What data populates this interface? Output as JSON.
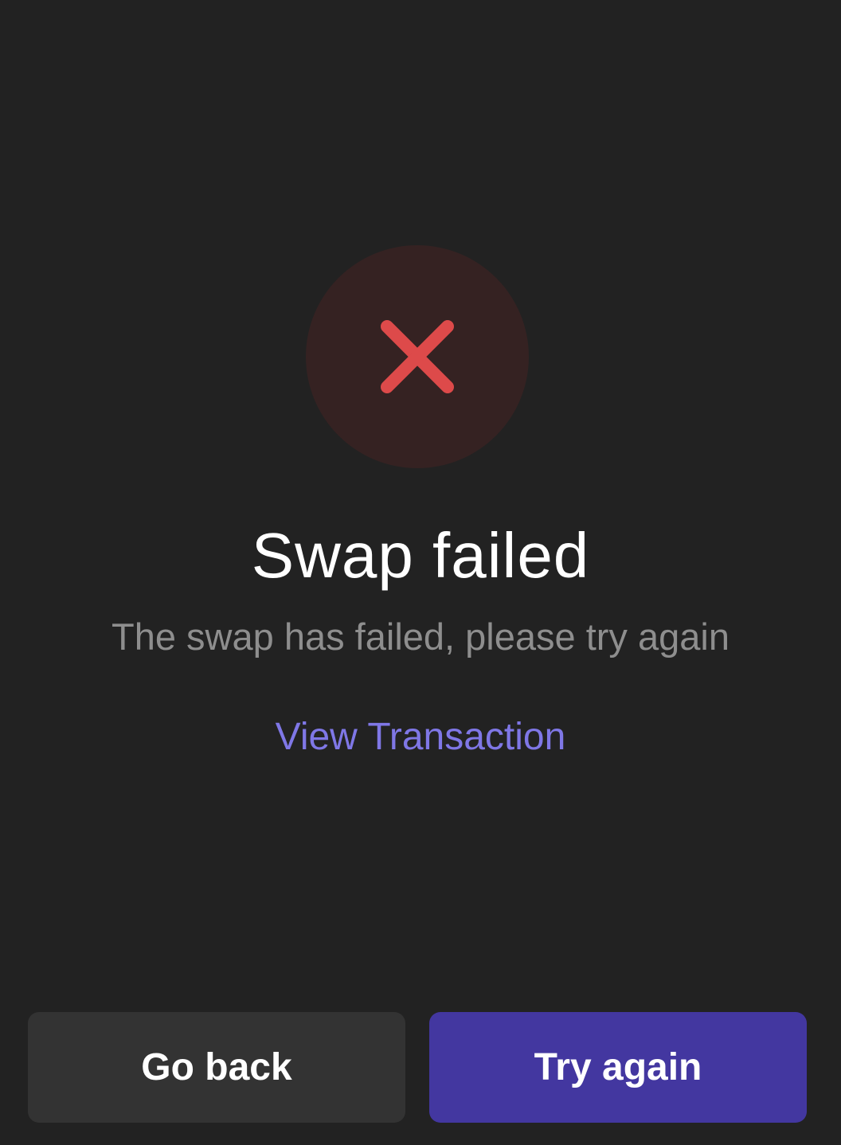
{
  "status": {
    "icon": "close-icon",
    "icon_color": "#dd4a4a",
    "background_color": "#352222"
  },
  "title": "Swap failed",
  "subtitle": "The swap has failed, please try again",
  "link": {
    "label": "View Transaction",
    "color": "#7f77e6"
  },
  "actions": {
    "back_label": "Go back",
    "retry_label": "Try again",
    "retry_color": "#4337a0"
  }
}
